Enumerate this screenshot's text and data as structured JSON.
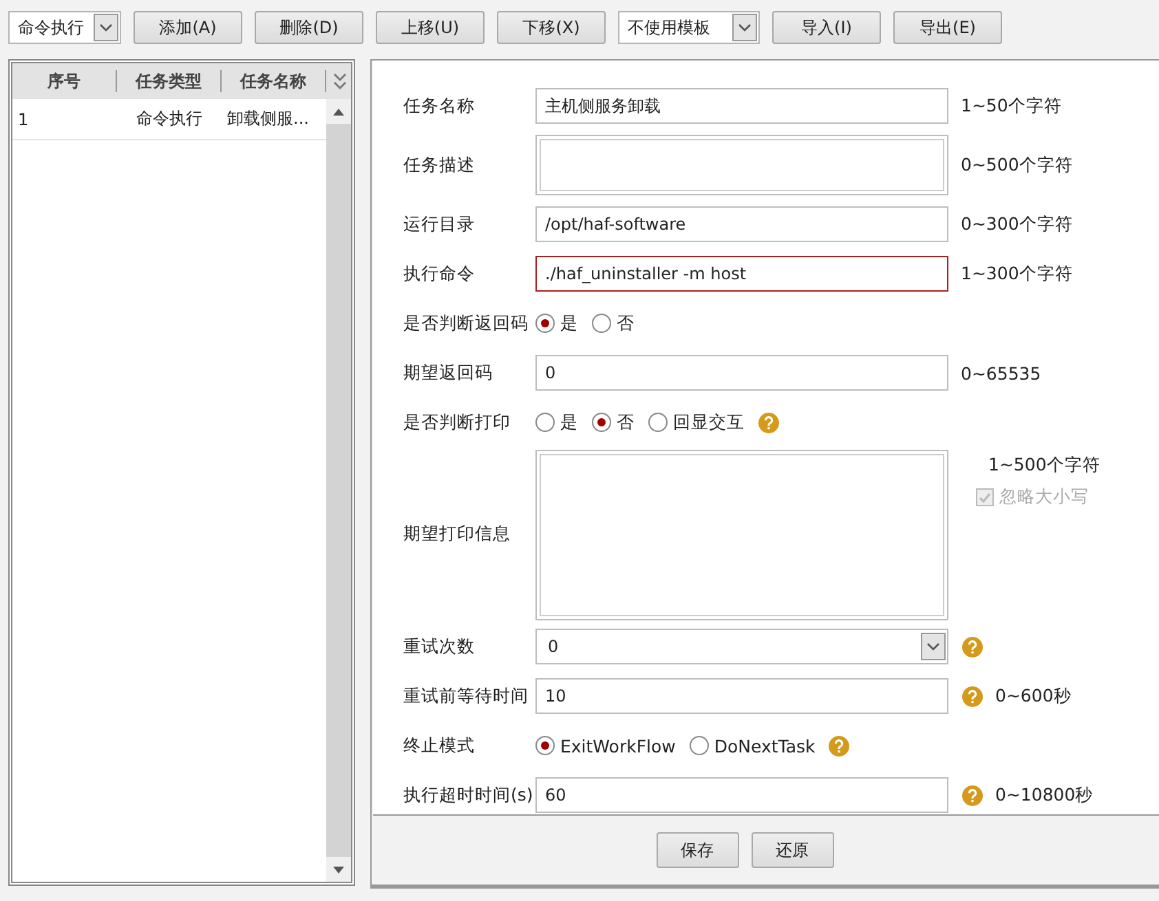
{
  "toolbar": {
    "type_select": "命令执行",
    "buttons": [
      "添加(A)",
      "删除(D)",
      "上移(U)",
      "下移(X)"
    ],
    "template_select": "不使用模板",
    "buttons_right": [
      "导入(I)",
      "导出(E)"
    ]
  },
  "task_table": {
    "columns": [
      "序号",
      "任务类型",
      "任务名称"
    ],
    "rows": [
      {
        "cells": [
          "1",
          "命令执行",
          "卸载侧服..."
        ]
      }
    ]
  },
  "form": {
    "rows": [
      {
        "kind": "text",
        "label": "任务名称",
        "value": "主机侧服务卸载",
        "hint": "1~50个字符"
      },
      {
        "kind": "textarea",
        "label": "任务描述",
        "value": "",
        "hint": "0~500个字符"
      },
      {
        "kind": "text",
        "label": "运行目录",
        "value": "/opt/haf-software",
        "hint": "0~300个字符"
      },
      {
        "kind": "text",
        "label": "执行命令",
        "value": "./haf_uninstaller -m host",
        "hint": "1~300个字符",
        "focused": true
      },
      {
        "kind": "radio",
        "label": "是否判断返回码",
        "options": [
          {
            "label": "是",
            "selected": true
          },
          {
            "label": "否",
            "selected": false
          }
        ]
      },
      {
        "kind": "text",
        "label": "期望返回码",
        "value": "0",
        "hint": "0~65535"
      },
      {
        "kind": "radio",
        "label": "是否判断打印",
        "options": [
          {
            "label": "是",
            "selected": false
          },
          {
            "label": "否",
            "selected": true
          },
          {
            "label": "回显交互",
            "selected": false
          }
        ],
        "help": true
      },
      {
        "kind": "bigtext",
        "label": "期望打印信息",
        "value": "",
        "hint": "1~500个字符",
        "checkbox": {
          "label": "忽略大小写",
          "checked": true,
          "disabled": true
        }
      },
      {
        "kind": "select",
        "label": "重试次数",
        "value": "0",
        "help": true
      },
      {
        "kind": "text",
        "label": "重试前等待时间",
        "value": "10",
        "hint": "0~600秒",
        "help": true
      },
      {
        "kind": "radio",
        "label": "终止模式",
        "options": [
          {
            "label": "ExitWorkFlow",
            "selected": true
          },
          {
            "label": "DoNextTask",
            "selected": false
          }
        ],
        "help": true
      },
      {
        "kind": "text",
        "label": "执行超时时间(s)",
        "value": "60",
        "hint": "0~10800秒",
        "help": true
      }
    ]
  },
  "footer_buttons": [
    "保存",
    "还原"
  ]
}
